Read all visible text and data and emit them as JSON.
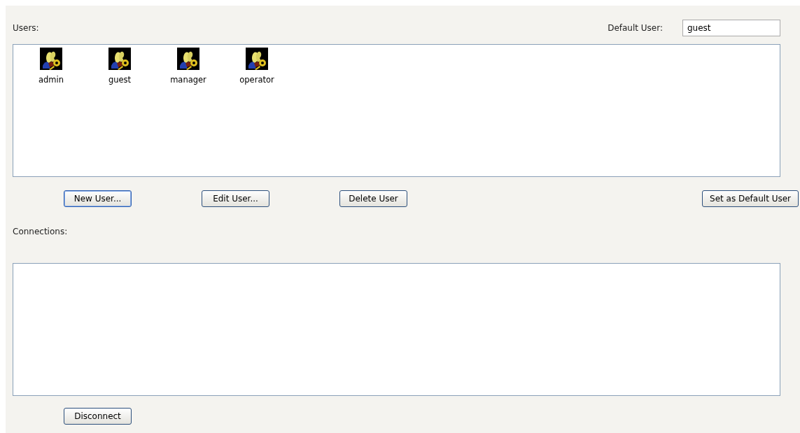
{
  "users_label": "Users:",
  "default_user": {
    "label": "Default User:",
    "value": "guest"
  },
  "users": [
    {
      "name": "admin"
    },
    {
      "name": "guest"
    },
    {
      "name": "manager"
    },
    {
      "name": "operator"
    }
  ],
  "user_buttons": [
    {
      "label": "New User...",
      "focused": true
    },
    {
      "label": "Edit User...",
      "focused": false
    },
    {
      "label": "Delete User",
      "focused": false
    }
  ],
  "default_button": {
    "label": "Set as Default User",
    "focused": false
  },
  "connections_label": "Connections:",
  "connection_buttons": [
    {
      "label": "Disconnect",
      "focused": false
    }
  ]
}
